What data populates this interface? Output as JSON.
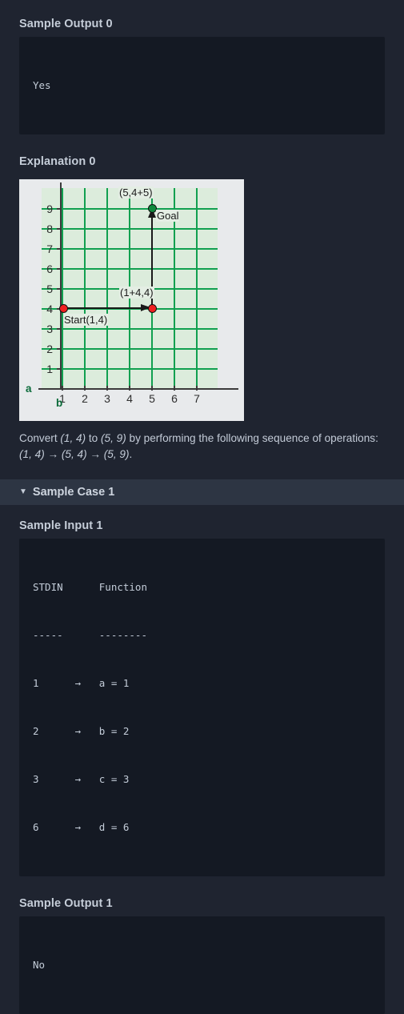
{
  "sample_output_0": {
    "heading": "Sample Output 0",
    "value": "Yes"
  },
  "explanation_0": {
    "heading": "Explanation 0",
    "caption_parts": {
      "lead": "Convert ",
      "from": "(1, 4)",
      "mid1": " to ",
      "to": "(5, 9)",
      "mid2": " by performing the following sequence of operations: ",
      "seq": "(1, 4) → (5, 4) → (5, 9)",
      "end": "."
    }
  },
  "chart_data": {
    "type": "scatter",
    "title": "",
    "xlabel": "b",
    "ylabel": "a",
    "xticks": [
      1,
      2,
      3,
      4,
      5,
      6,
      7
    ],
    "yticks": [
      1,
      2,
      3,
      4,
      5,
      6,
      7,
      8,
      9
    ],
    "xlim": [
      0,
      8
    ],
    "ylim": [
      0,
      10
    ],
    "grid": true,
    "legend": "none",
    "plot_bg": "#dcecdc",
    "grid_color": "#11a050",
    "canvas_bg": "#e8eaec",
    "points": [
      {
        "x": 1,
        "y": 4,
        "label": "Start(1,4)",
        "label_pos": "below-right",
        "color": "#f02020",
        "name": "start-point"
      },
      {
        "x": 5,
        "y": 4,
        "label": "(1+4,4)",
        "label_pos": "above-left",
        "color": "#f02020",
        "name": "intermediate-point"
      },
      {
        "x": 5,
        "y": 9,
        "label": "(5,4+5)",
        "label_pos": "above-left",
        "color": "#0f8a3c",
        "name": "goal-point"
      }
    ],
    "goal_label": "Goal",
    "arrows": [
      {
        "from": [
          1,
          4
        ],
        "to": [
          5,
          4
        ],
        "direction": "right"
      },
      {
        "from": [
          5,
          4
        ],
        "to": [
          5,
          9
        ],
        "direction": "up"
      }
    ]
  },
  "sample_case_1": {
    "caret": "▼",
    "title": "Sample Case 1"
  },
  "sample_input_1": {
    "heading": "Sample Input 1",
    "lines": [
      "STDIN      Function",
      "-----      --------",
      "1      →   a = 1",
      "2      →   b = 2",
      "3      →   c = 3",
      "6      →   d = 6"
    ]
  },
  "sample_output_1": {
    "heading": "Sample Output 1",
    "value": "No"
  }
}
